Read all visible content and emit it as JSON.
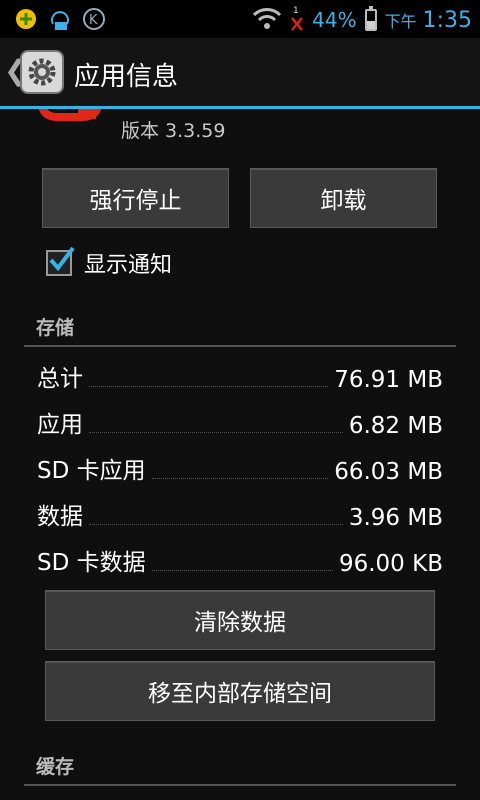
{
  "status_bar": {
    "battery_percent": "44%",
    "ampm": "下午",
    "time": "1:35",
    "battery_level": 0.44,
    "notification_icons": [
      "app-notify-icon",
      "bluetooth-chat-icon",
      "k-app-icon"
    ],
    "signal_icons": [
      "wifi-icon",
      "no-signal-icon"
    ]
  },
  "action_bar": {
    "title": "应用信息",
    "back_icon": "chevron-left-icon",
    "app_icon": "settings-gear-icon"
  },
  "app": {
    "version": "版本 3.3.59"
  },
  "buttons": {
    "force_stop": "强行停止",
    "uninstall": "卸载",
    "clear_data": "清除数据",
    "move_storage": "移至内部存储空间"
  },
  "notification_checkbox": {
    "label": "显示通知",
    "checked": true
  },
  "storage": {
    "header": "存储",
    "rows": [
      {
        "label": "总计",
        "value": "76.91 MB"
      },
      {
        "label": "应用",
        "value": "6.82 MB"
      },
      {
        "label": "SD 卡应用",
        "value": "66.03 MB"
      },
      {
        "label": "数据",
        "value": "3.96 MB"
      },
      {
        "label": "SD 卡数据",
        "value": "96.00 KB"
      }
    ]
  },
  "cache": {
    "header": "缓存"
  },
  "colors": {
    "accent": "#33b5e5",
    "background": "#0f0f0f",
    "button": "#3a3a3a"
  }
}
